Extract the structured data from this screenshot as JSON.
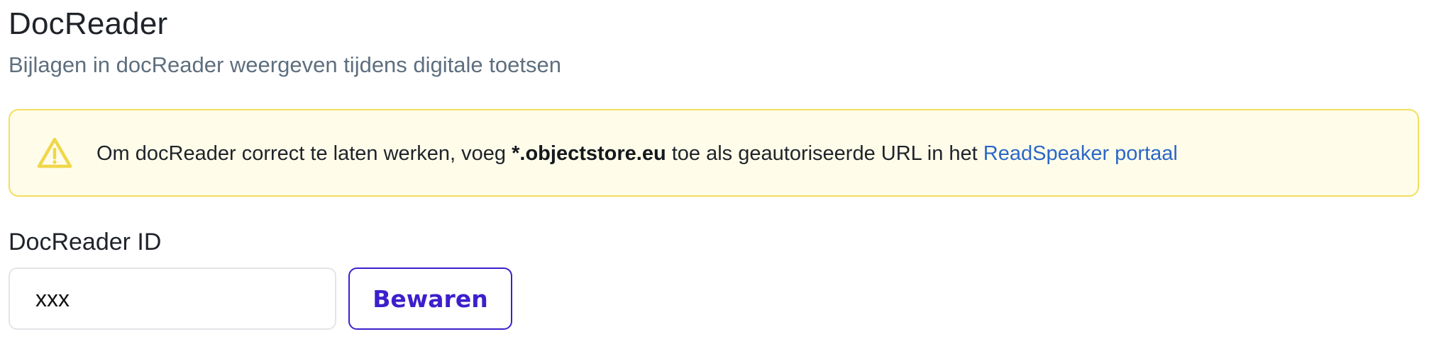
{
  "header": {
    "title": "DocReader",
    "subtitle": "Bijlagen in docReader weergeven tijdens digitale toetsen"
  },
  "alert": {
    "icon": "warning-triangle-icon",
    "text_before": "Om docReader correct te laten werken, voeg ",
    "bold_text": "*.objectstore.eu",
    "text_after": " toe als geautoriseerde URL in het ",
    "link_text": "ReadSpeaker portaal",
    "colors": {
      "background": "#fffdea",
      "border": "#f3df5c",
      "icon": "#f0d64a",
      "link": "#2b67c9"
    }
  },
  "form": {
    "label": "DocReader ID",
    "input_value": "xxx",
    "save_label": "Bewaren",
    "button_color": "#3d1fcc"
  }
}
